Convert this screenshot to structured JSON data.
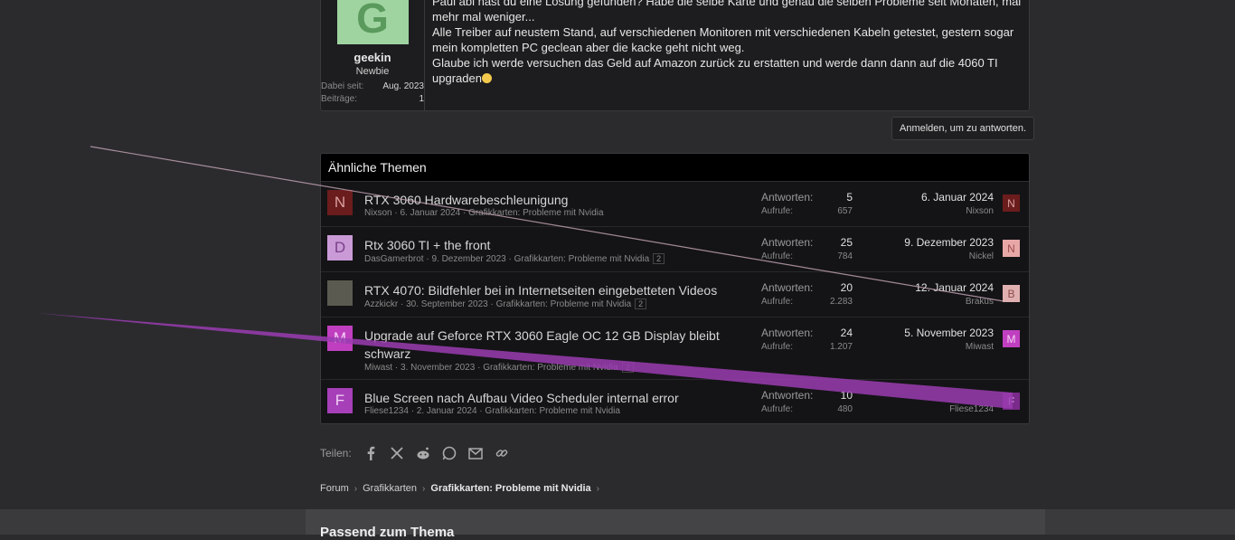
{
  "post": {
    "user": {
      "avatar_letter": "G",
      "name": "geekin",
      "role": "Newbie",
      "stats": [
        {
          "key": "Dabei seit:",
          "value": "Aug. 2023"
        },
        {
          "key": "Beiträge:",
          "value": "1"
        }
      ]
    },
    "lines": [
      "Paul abi hast du eine Lösung gefunden? Habe die selbe Karte und genau die selben Probleme seit Monaten, mal mehr mal weniger...",
      "Alle Treiber auf neustem Stand, auf verschiedenen Monitoren mit verschiedenen Kabeln getestet, gestern sogar mein kompletten PC geclean aber die kacke geht nicht weg.",
      "Glaube ich werde versuchen das Geld auf Amazon zurück zu erstatten und werde dann dann auf die 4060 TI upgraden"
    ],
    "smiley_icon": "smiley-icon"
  },
  "reply_button": "Anmelden, um zu antworten.",
  "similar": {
    "title": "Ähnliche Themen",
    "answers_label": "Antworten:",
    "views_label": "Aufrufe:",
    "threads": [
      {
        "avatar": "N",
        "avatar_bg": "#6b1c1c",
        "avatar_fg": "#d9a0a0",
        "title": "RTX 3060 Hardwarebeschleunigung",
        "author": "Nixson",
        "date": "6. Januar 2024",
        "forum": "Grafikkarten: Probleme mit Nvidia",
        "pages": "",
        "answers": "5",
        "views": "657",
        "last_date": "6. Januar 2024",
        "last_user": "Nixson",
        "last_avatar": "N",
        "last_bg": "#6b1c1c",
        "last_fg": "#d9a0a0"
      },
      {
        "avatar": "D",
        "avatar_bg": "#c99ad6",
        "avatar_fg": "#7a3f8a",
        "title": "Rtx 3060 TI + the front",
        "author": "DasGamerbrot",
        "date": "9. Dezember 2023",
        "forum": "Grafikkarten: Probleme mit Nvidia",
        "pages": "2",
        "answers": "25",
        "views": "784",
        "last_date": "9. Dezember 2023",
        "last_user": "Nickel",
        "last_avatar": "N",
        "last_bg": "#e8a7a7",
        "last_fg": "#9a4b4b"
      },
      {
        "avatar": "",
        "avatar_bg": "#5a5a50",
        "avatar_fg": "#ffffff",
        "title": "RTX 4070: Bildfehler bei in Internetseiten eingebetteten Videos",
        "author": "Azzkickr",
        "date": "30. September 2023",
        "forum": "Grafikkarten: Probleme mit Nvidia",
        "pages": "2",
        "answers": "20",
        "views": "2.283",
        "last_date": "12. Januar 2024",
        "last_user": "Brakus",
        "last_avatar": "B",
        "last_bg": "#e0b0b0",
        "last_fg": "#8a4a4a"
      },
      {
        "avatar": "M",
        "avatar_bg": "#c03fc0",
        "avatar_fg": "#f4d0f4",
        "title": "Upgrade auf Geforce RTX 3060 Eagle OC 12 GB Display bleibt schwarz",
        "author": "Miwast",
        "date": "3. November 2023",
        "forum": "Grafikkarten: Probleme mit Nvidia",
        "pages": "2",
        "answers": "24",
        "views": "1.207",
        "last_date": "5. November 2023",
        "last_user": "Miwast",
        "last_avatar": "M",
        "last_bg": "#c03fc0",
        "last_fg": "#f4d0f4"
      },
      {
        "avatar": "F",
        "avatar_bg": "#a63fb8",
        "avatar_fg": "#f0d0f4",
        "title": "Blue Screen nach Aufbau Video Scheduler internal error",
        "author": "Fliese1234",
        "date": "2. Januar 2024",
        "forum": "Grafikkarten: Probleme mit Nvidia",
        "pages": "",
        "answers": "10",
        "views": "480",
        "last_date": "",
        "last_user": "Fliese1234",
        "last_avatar": "F",
        "last_bg": "#7a2a8a",
        "last_fg": "#f0d0f4"
      }
    ]
  },
  "share": {
    "label": "Teilen:",
    "icons": [
      "facebook-icon",
      "x-icon",
      "reddit-icon",
      "whatsapp-icon",
      "email-icon",
      "link-icon"
    ]
  },
  "breadcrumb": [
    "Forum",
    "Grafikkarten",
    "Grafikkarten: Probleme mit Nvidia"
  ],
  "footer_title": "Passend zum Thema"
}
